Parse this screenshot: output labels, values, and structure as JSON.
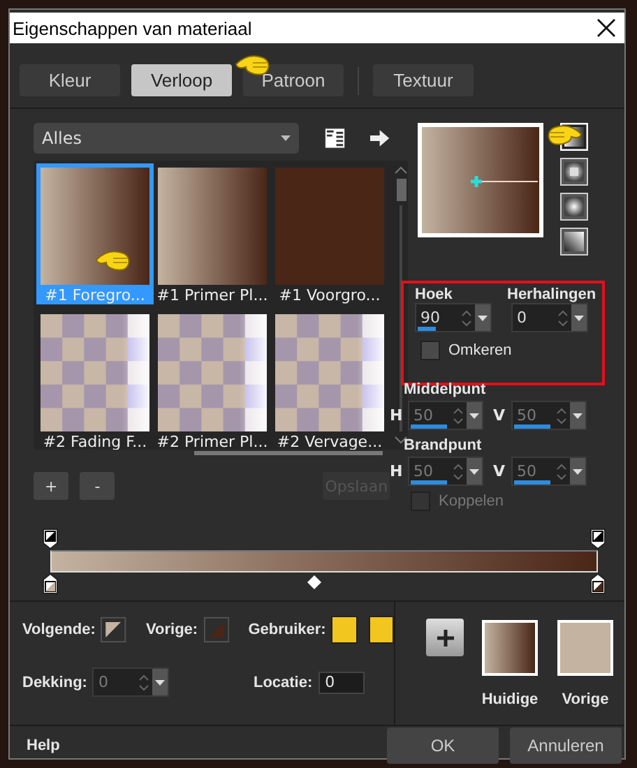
{
  "window": {
    "title": "Eigenschappen van materiaal"
  },
  "tabs": [
    {
      "label": "Kleur",
      "selected": false
    },
    {
      "label": "Verloop",
      "selected": true
    },
    {
      "label": "Patroon",
      "selected": false
    },
    {
      "label": "Textuur",
      "selected": false
    }
  ],
  "category_dropdown": {
    "value": "Alles"
  },
  "gradients": [
    {
      "label": "#1 Foregro...",
      "selected": true,
      "kind": "fade"
    },
    {
      "label": "#1 Primer Pl...",
      "selected": false,
      "kind": "fade"
    },
    {
      "label": "#1 Voorgro...",
      "selected": false,
      "kind": "solid"
    },
    {
      "label": "#2 Fading F...",
      "selected": false,
      "kind": "checker"
    },
    {
      "label": "#2 Primer Pl...",
      "selected": false,
      "kind": "checker"
    },
    {
      "label": "#2 Vervage...",
      "selected": false,
      "kind": "checker"
    }
  ],
  "style_buttons": [
    {
      "kind": "linear",
      "selected": true
    },
    {
      "kind": "rectangular",
      "selected": false
    },
    {
      "kind": "radial",
      "selected": false
    },
    {
      "kind": "corner",
      "selected": false
    }
  ],
  "angle": {
    "label": "Hoek",
    "value": "90",
    "level": 0.25
  },
  "repeats": {
    "label": "Herhalingen",
    "value": "0"
  },
  "reverse": {
    "label": "Omkeren",
    "checked": false
  },
  "center": {
    "label": "Middelpunt",
    "h": {
      "label": "H",
      "value": "50",
      "level": 0.5,
      "disabled": true
    },
    "v": {
      "label": "V",
      "value": "50",
      "level": 0.5,
      "disabled": true
    }
  },
  "focus": {
    "label": "Brandpunt",
    "h": {
      "label": "H",
      "value": "50",
      "level": 0.5,
      "disabled": true
    },
    "v": {
      "label": "V",
      "value": "50",
      "level": 0.5,
      "disabled": true
    }
  },
  "link": {
    "label": "Koppelen",
    "checked": false,
    "disabled": true
  },
  "editor_buttons": [
    {
      "label": "+",
      "disabled": false
    },
    {
      "label": "-",
      "disabled": false
    },
    {
      "label": "Opslaan",
      "disabled": true
    }
  ],
  "next": {
    "label": "Volgende:"
  },
  "previous": {
    "label": "Vorige:"
  },
  "user": {
    "label": "Gebruiker:",
    "swatches": [
      {
        "color": "#f2c61e"
      },
      {
        "color": "#f2c61e"
      }
    ]
  },
  "opacity": {
    "label": "Dekking:",
    "value": "0",
    "disabled": true
  },
  "location": {
    "label": "Locatie:",
    "value": "0"
  },
  "previews": [
    {
      "label": "Huidige",
      "kind": "gradient"
    },
    {
      "label": "Vorige",
      "kind": "solid"
    }
  ],
  "help": "Help",
  "buttons": [
    "OK",
    "Annuleren"
  ]
}
